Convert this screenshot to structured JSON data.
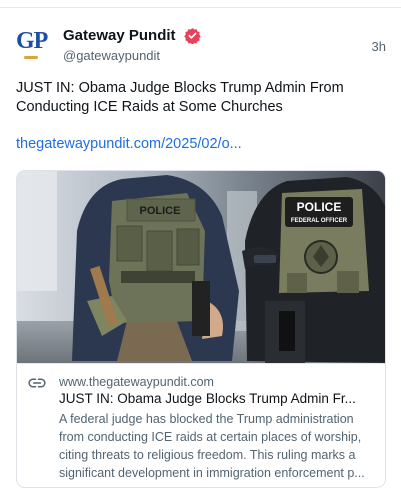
{
  "account": {
    "display_name": "Gateway Pundit",
    "handle": "@gatewaypundit",
    "avatar_initials": "GP",
    "verified": true,
    "timestamp": "3h"
  },
  "post": {
    "text": "JUST IN: Obama Judge Blocks Trump Admin From Conducting ICE Raids at Some Churches",
    "link_text": "thegatewaypundit.com/2025/02/o..."
  },
  "card": {
    "image_vest_labels": [
      "POLICE",
      "POLICE",
      "FEDERAL OFFICER"
    ],
    "domain": "www.thegatewaypundit.com",
    "title": "JUST IN: Obama Judge Blocks Trump Admin Fr...",
    "description": "A federal judge has blocked the Trump administration from conducting ICE raids at certain places of worship, citing threats to religious freedom. This ruling marks a significant development in immigration enforcement p..."
  },
  "icons": {
    "verified": "verified-badge-icon",
    "link": "link-icon"
  },
  "colors": {
    "link": "#1f6ee0",
    "verified_badge": "#e8415a",
    "brand_blue": "#1d4fa3",
    "secondary_text": "#536471"
  }
}
